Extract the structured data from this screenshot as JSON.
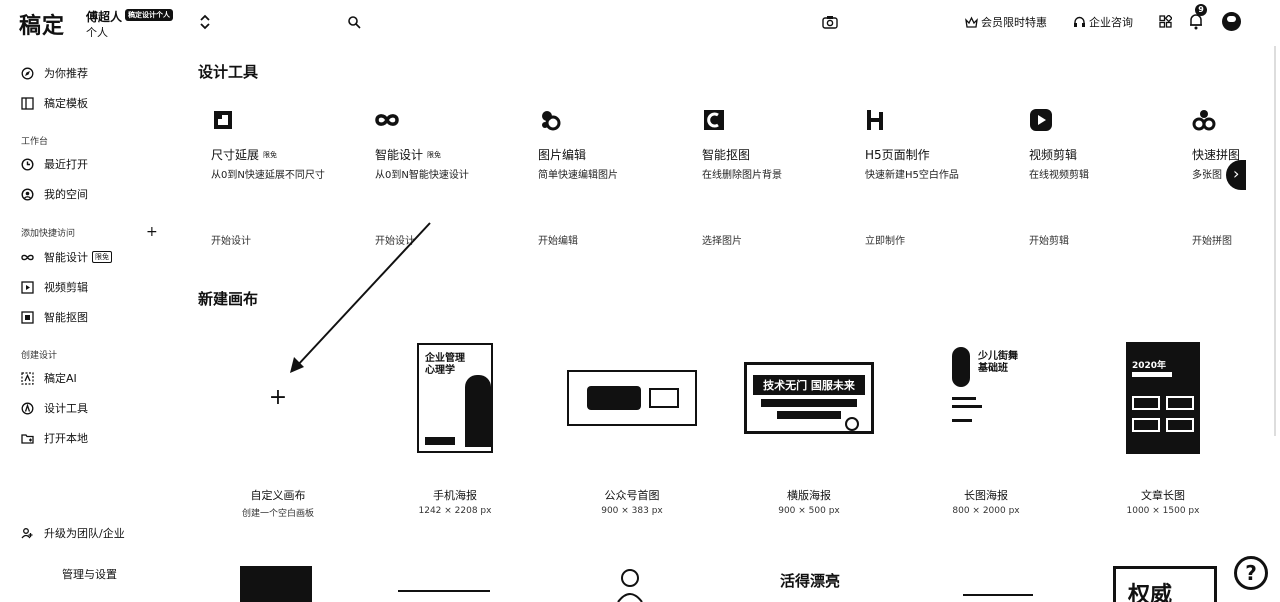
{
  "topbar": {
    "logo": "稿定",
    "user_name": "傅超人",
    "user_badge": "稿定设计个人",
    "user_type": "个人",
    "member_link": "会员限时特惠",
    "consult_link": "企业咨询",
    "notification_count": "9"
  },
  "sidebar": {
    "items": [
      {
        "label": "为你推荐",
        "icon": "compass-icon"
      },
      {
        "label": "稿定模板",
        "icon": "template-icon"
      },
      {
        "label": "最近打开",
        "icon": "clock-icon"
      },
      {
        "label": "我的空间",
        "icon": "user-circle-icon"
      },
      {
        "label": "智能设计",
        "icon": "infinity-icon",
        "tag": "限免"
      },
      {
        "label": "视频剪辑",
        "icon": "video-icon"
      },
      {
        "label": "智能抠图",
        "icon": "cutout-icon"
      },
      {
        "label": "稿定AI",
        "icon": "ai-icon"
      },
      {
        "label": "设计工具",
        "icon": "design-tool-icon"
      },
      {
        "label": "打开本地",
        "icon": "folder-icon"
      }
    ],
    "section_work": "工作台",
    "section_quick": "添加快捷访问",
    "section_create": "创建设计",
    "upgrade": "升级为团队/企业",
    "manage": "管理与设置"
  },
  "main": {
    "tools_title": "设计工具",
    "canvas_title": "新建画布",
    "tools": [
      {
        "name": "尺寸延展",
        "tag": "限免",
        "desc": "从0到N快速延展不同尺寸",
        "action": "开始设计",
        "icon": "resize-icon"
      },
      {
        "name": "智能设计",
        "tag": "限免",
        "desc": "从0到N智能快速设计",
        "action": "开始设计",
        "icon": "infinity-icon"
      },
      {
        "name": "图片编辑",
        "tag": "",
        "desc": "简单快速编辑图片",
        "action": "开始编辑",
        "icon": "image-edit-icon"
      },
      {
        "name": "智能抠图",
        "tag": "",
        "desc": "在线删除图片背景",
        "action": "选择图片",
        "icon": "cutout-icon"
      },
      {
        "name": "H5页面制作",
        "tag": "",
        "desc": "快速新建H5空白作品",
        "action": "立即制作",
        "icon": "h5-icon"
      },
      {
        "name": "视频剪辑",
        "tag": "",
        "desc": "在线视频剪辑",
        "action": "开始剪辑",
        "icon": "video-icon"
      },
      {
        "name": "快速拼图",
        "tag": "",
        "desc": "多张图",
        "action": "开始拼图",
        "icon": "puzzle-icon"
      }
    ],
    "canvases": [
      {
        "name": "自定义画布",
        "size": "创建一个空白画板"
      },
      {
        "name": "手机海报",
        "size": "1242 × 2208 px",
        "thumb_text": "企业管理心理学"
      },
      {
        "name": "公众号首图",
        "size": "900 × 383 px"
      },
      {
        "name": "横版海报",
        "size": "900 × 500 px",
        "thumb_text": "技术无门 国服未来"
      },
      {
        "name": "长图海报",
        "size": "800 × 2000 px",
        "thumb_text": "少儿街舞基础班"
      },
      {
        "name": "文章长图",
        "size": "1000 × 1500 px",
        "thumb_text": "2020年"
      }
    ],
    "bottom_text_1": "活得漂亮",
    "bottom_text_2": "权威"
  }
}
